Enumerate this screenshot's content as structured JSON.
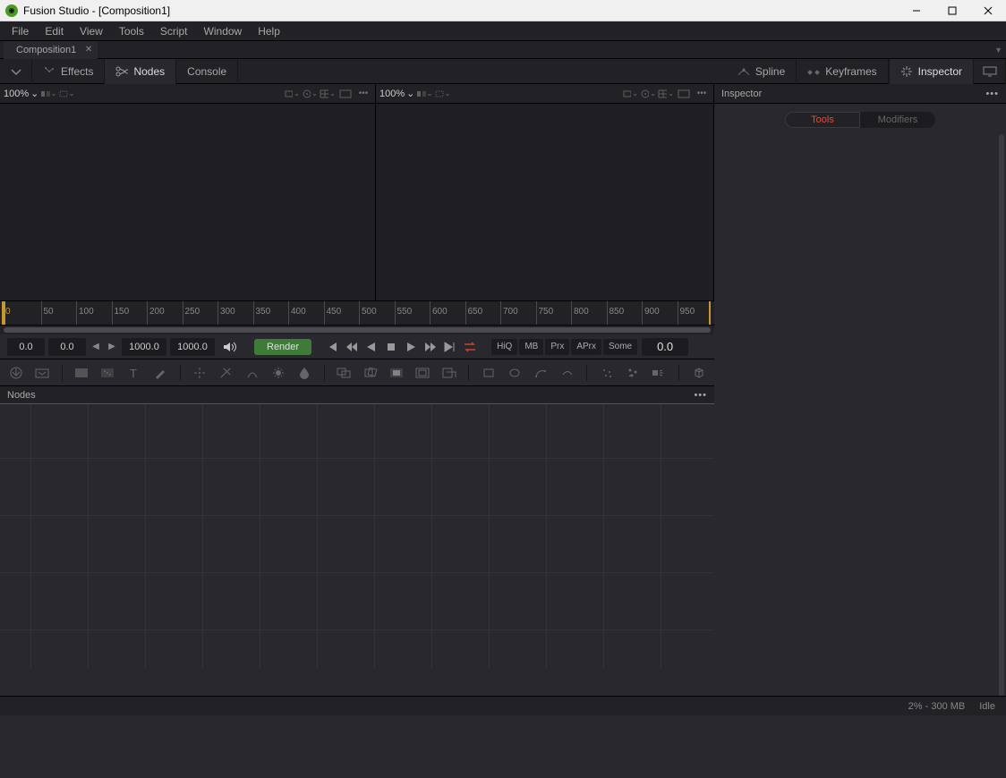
{
  "app": {
    "title": "Fusion Studio - [Composition1]"
  },
  "menu": {
    "items": [
      "File",
      "Edit",
      "View",
      "Tools",
      "Script",
      "Window",
      "Help"
    ]
  },
  "tabs": {
    "active": "Composition1"
  },
  "toolbar": {
    "effects": "Effects",
    "nodes": "Nodes",
    "console": "Console",
    "spline": "Spline",
    "keyframes": "Keyframes",
    "inspector": "Inspector"
  },
  "viewer": {
    "zoom_left": "100%",
    "zoom_right": "100%"
  },
  "inspector": {
    "title": "Inspector",
    "tab_tools": "Tools",
    "tab_modifiers": "Modifiers"
  },
  "timeline": {
    "ticks": [
      50,
      100,
      150,
      200,
      250,
      300,
      350,
      400,
      450,
      500,
      550,
      600,
      650,
      700,
      750,
      800,
      850,
      900,
      950
    ],
    "start_in": "0.0",
    "current": "0.0",
    "end_in": "1000.0",
    "end_out": "1000.0",
    "render": "Render",
    "hiq": "HiQ",
    "mb": "MB",
    "prx": "Prx",
    "aprx": "APrx",
    "some": "Some",
    "time_display": "0.0"
  },
  "nodes": {
    "title": "Nodes"
  },
  "status": {
    "mem": "2% - 300 MB",
    "state": "Idle"
  }
}
